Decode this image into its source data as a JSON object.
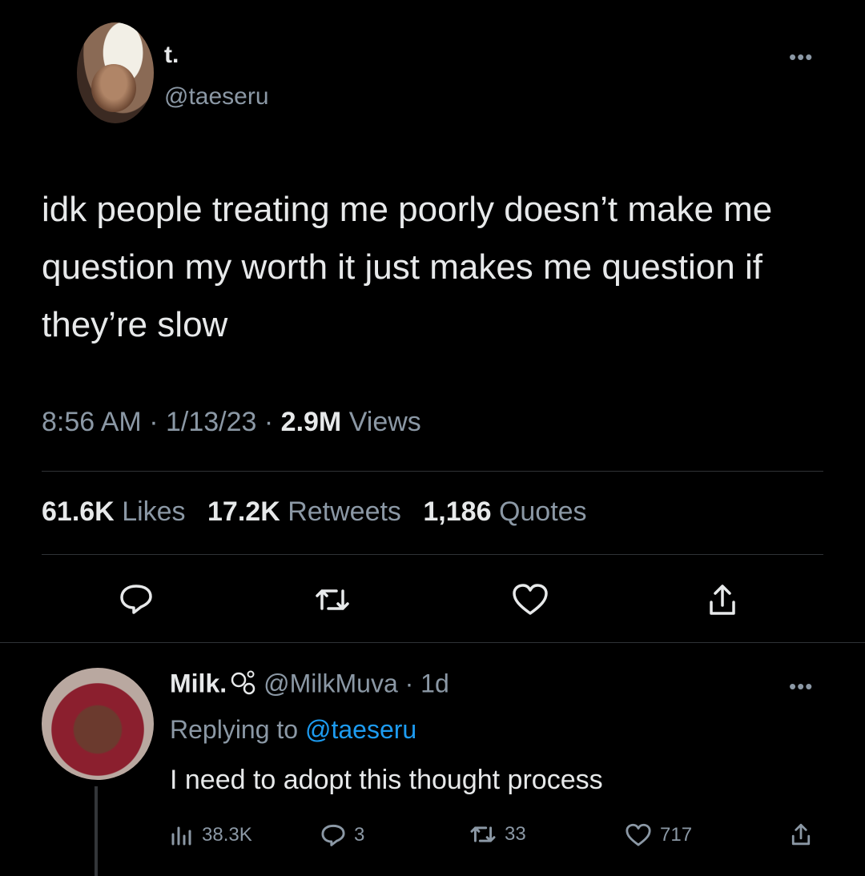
{
  "tweet": {
    "author_name": "t.",
    "author_handle": "@taeseru",
    "text": "idk people treating me poorly doesn’t make me question my worth it just makes me question if they’re slow",
    "time": "8:56 AM",
    "date": "1/13/23",
    "views_count": "2.9M",
    "views_label": "Views",
    "likes_count": "61.6K",
    "likes_label": "Likes",
    "retweets_count": "17.2K",
    "retweets_label": "Retweets",
    "quotes_count": "1,186",
    "quotes_label": "Quotes",
    "separator": "·"
  },
  "reply": {
    "author_name": "Milk.",
    "author_handle": "@MilkMuva",
    "age": "1d",
    "replying_prefix": "Replying to",
    "replying_to": "@taeseru",
    "text": "I need to adopt this thought process",
    "views": "38.3K",
    "replies": "3",
    "retweets": "33",
    "likes": "717"
  },
  "icons": {
    "more": "more-dots-icon",
    "reply": "reply-bubble-icon",
    "retweet": "retweet-icon",
    "like": "heart-icon",
    "share": "share-icon",
    "views": "views-bars-icon",
    "bubbles": "bubbles-emoji-icon"
  },
  "colors": {
    "background": "#000000",
    "text": "#e7e9ea",
    "muted": "#8b98a5",
    "link": "#1d9bf0",
    "divider": "#2f3336"
  }
}
